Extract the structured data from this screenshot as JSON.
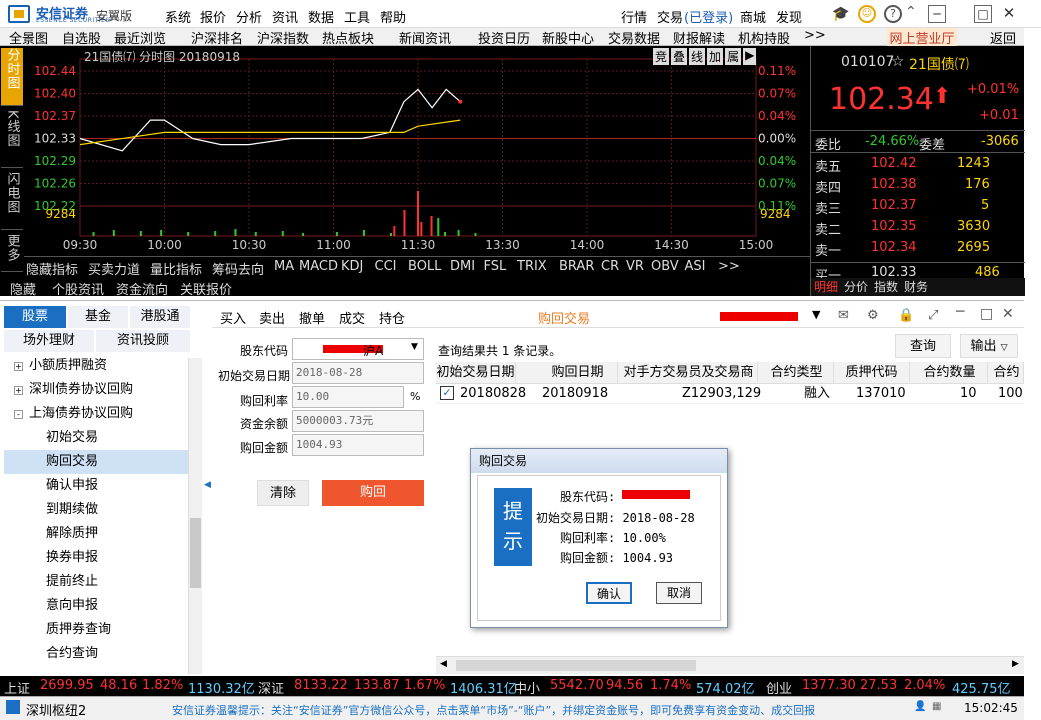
{
  "app": {
    "logo": "安信证券",
    "logo_sub": "ESSENCE SECURITIES",
    "edition": "安翼版"
  },
  "menu": [
    "系统",
    "报价",
    "分析",
    "资讯",
    "数据",
    "工具",
    "帮助"
  ],
  "right_menu": {
    "quote": "行情",
    "trade": "交易",
    "login": "(已登录)",
    "mall": "商城",
    "discover": "发现"
  },
  "nav": [
    "全景图",
    "自选股",
    "最近浏览",
    "沪深排名",
    "沪深指数",
    "热点板块",
    "新闻资讯",
    "投资日历",
    "新股中心",
    "交易数据",
    "财报解读",
    "机构持股",
    ">>"
  ],
  "nav_online": "网上营业厅",
  "nav_back": "返回",
  "chart": {
    "title": "21国债⑺ 分时图 20180918",
    "tools": [
      "竞",
      "叠",
      "线",
      "加",
      "属",
      "▶"
    ],
    "left_tabs": [
      "分时图",
      "K线图",
      "闪电图",
      "更多"
    ],
    "price_ticks": [
      "102.44",
      "102.40",
      "102.37",
      "102.33",
      "102.29",
      "102.26",
      "102.22"
    ],
    "pct_ticks": [
      "0.11%",
      "0.07%",
      "0.04%",
      "0.00%",
      "0.04%",
      "0.07%",
      "0.11%"
    ],
    "vol_label": "9284",
    "time_ticks": [
      "09:30",
      "10:00",
      "10:30",
      "11:00",
      "11:30",
      "13:30",
      "14:00",
      "14:30",
      "15:00"
    ]
  },
  "chart_data": {
    "type": "line",
    "title": "21国债⑺ 分时图 20180918",
    "series": [
      {
        "name": "price",
        "x": [
          "09:30",
          "09:45",
          "09:55",
          "10:00",
          "10:10",
          "10:20",
          "10:30",
          "10:45",
          "11:00",
          "11:10",
          "11:20",
          "11:25",
          "11:30",
          "11:35",
          "11:40",
          "11:45"
        ],
        "values": [
          102.33,
          102.31,
          102.36,
          102.36,
          102.33,
          102.32,
          102.32,
          102.33,
          102.33,
          102.33,
          102.34,
          102.39,
          102.41,
          102.38,
          102.41,
          102.39
        ]
      },
      {
        "name": "avg",
        "x": [
          "09:30",
          "10:00",
          "10:30",
          "11:00",
          "11:25",
          "11:30",
          "11:45"
        ],
        "values": [
          102.32,
          102.34,
          102.34,
          102.34,
          102.34,
          102.35,
          102.36
        ]
      }
    ],
    "ylim": [
      102.22,
      102.44
    ]
  },
  "quote": {
    "code": "010107",
    "name": "21国债⑺",
    "price": "102.34",
    "arrow": "⬆",
    "chg_pct": "+0.01%",
    "chg": "+0.01",
    "ratio_label": "委比",
    "ratio": "-24.66%",
    "diff_label": "委差",
    "diff": "-3066",
    "asks": [
      {
        "l": "卖五",
        "p": "102.42",
        "v": "1243"
      },
      {
        "l": "卖四",
        "p": "102.38",
        "v": "176"
      },
      {
        "l": "卖三",
        "p": "102.37",
        "v": "5"
      },
      {
        "l": "卖二",
        "p": "102.35",
        "v": "3630"
      },
      {
        "l": "卖一",
        "p": "102.34",
        "v": "2695"
      }
    ],
    "bid1": {
      "l": "买一",
      "p": "102.33",
      "v": "486"
    },
    "tabs": [
      "明细",
      "分价",
      "指数",
      "财务"
    ]
  },
  "indicators": [
    "隐藏指标",
    "买卖力道",
    "量比指标",
    "筹码去向",
    "MA",
    "MACD",
    "KDJ",
    "CCI",
    "BOLL",
    "DMI",
    "FSL",
    "TRIX",
    "BRAR",
    "CR",
    "VR",
    "OBV",
    "ASI",
    ">>"
  ],
  "sub_tabs": [
    "隐藏",
    "个股资讯",
    "资金流向",
    "关联报价"
  ],
  "trade": {
    "tabs": [
      "股票",
      "基金",
      "港股通"
    ],
    "tabs2": [
      "场外理财",
      "资讯投顾"
    ],
    "tree": [
      "小额质押融资",
      "深圳债券协议回购",
      "上海债券协议回购"
    ],
    "sub": [
      "初始交易",
      "购回交易",
      "确认申报",
      "到期续做",
      "解除质押",
      "换券申报",
      "提前终止",
      "意向申报",
      "质押券查询",
      "合约查询"
    ],
    "actions": [
      "买入",
      "卖出",
      "撤单",
      "成交",
      "持仓"
    ],
    "title": "购回交易",
    "form": {
      "holder": "股东代码",
      "market": "沪A",
      "init_date": "初始交易日期",
      "init_date_val": "2018-08-28",
      "rate": "购回利率",
      "rate_val": "10.00",
      "rate_unit": "%",
      "balance": "资金余额",
      "balance_val": "5000003.73元",
      "amount": "购回金额",
      "amount_val": "1004.93",
      "clear": "清除",
      "submit": "购回"
    },
    "result": "查询结果共 1 条记录。",
    "query": "查询",
    "export": "输出",
    "cols": [
      "初始交易日期",
      "购回日期",
      "对手方交易员及交易商",
      "合约类型",
      "质押代码",
      "合约数量",
      "合约"
    ],
    "row": [
      "20180828",
      "20180918",
      "Z12903,129",
      "融入",
      "137010",
      "10",
      "100"
    ]
  },
  "dialog": {
    "title": "购回交易",
    "tip": "提示",
    "l1": "股东代码:",
    "l2": "初始交易日期: 2018-08-28",
    "l3": "购回利率: 10.00%",
    "l4": "购回金额: 1004.93",
    "ok": "确认",
    "cancel": "取消"
  },
  "status": {
    "sh": "上证",
    "sh_v": "2699.95",
    "sh_c": "48.16",
    "sh_p": "1.82%",
    "sh_a": "1130.32亿",
    "sz": "深证",
    "sz_v": "8133.22",
    "sz_c": "133.87",
    "sz_p": "1.67%",
    "sz_a": "1406.31亿",
    "zx": "中小",
    "zx_v": "5542.70",
    "zx_c": "94.56",
    "zx_p": "1.74%",
    "zx_a": "574.02亿",
    "cy": "创业",
    "cy_v": "1377.30",
    "cy_c": "27.53",
    "cy_p": "2.04%",
    "cy_a": "425.75亿"
  },
  "bottom": {
    "server": "深圳枢纽2",
    "notice": "安信证券温馨提示：关注“安信证券”官方微信公众号，点击菜单“市场”-“账户”，并绑定资金账号，即可免费享有资金变动、成交回报",
    "time": "15:02:45"
  }
}
